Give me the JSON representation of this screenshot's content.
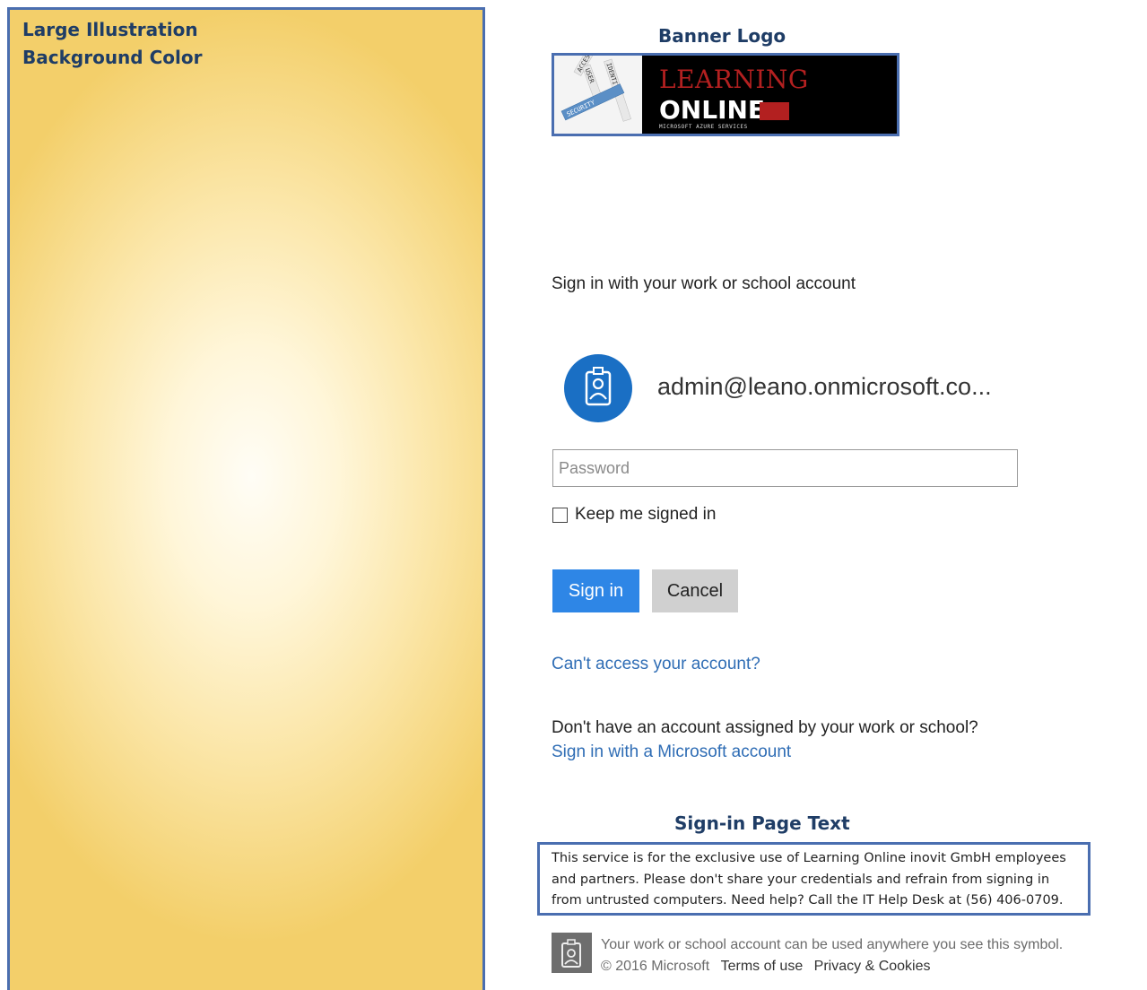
{
  "annotations": {
    "illustration_label_line1": "Large Illustration",
    "illustration_label_line2": "Background Color",
    "banner_logo_label": "Banner Logo",
    "signin_page_text_label": "Sign-in Page Text"
  },
  "logo": {
    "art_words": [
      "ACCESS",
      "USER",
      "IDENTITY",
      "SECURITY"
    ],
    "line1": "LEARNING",
    "line2": "ONLINE",
    "tagline": "MICROSOFT AZURE SERVICES"
  },
  "signin": {
    "heading": "Sign in with your work or school account",
    "account": "admin@leano.onmicrosoft.co...",
    "password_placeholder": "Password",
    "keep_signed_in": "Keep me signed in",
    "sign_in_button": "Sign in",
    "cancel_button": "Cancel",
    "cant_access_link": "Can't access your account?",
    "no_account_text": "Don't have an account assigned by your work or school?",
    "microsoft_account_link": "Sign in with a Microsoft account",
    "page_text": "This service is for the exclusive use of Learning Online inovit GmbH employees and partners. Please don't share your credentials and refrain from signing in from untrusted computers. Need help? Call the IT Help Desk at (56) 406-0709."
  },
  "footer": {
    "text": "Your work or school account can be used anywhere you see this symbol. © 2016 Microsoft",
    "terms": "Terms of use",
    "privacy": "Privacy & Cookies"
  },
  "colors": {
    "accent_blue": "#2e86e6",
    "link_blue": "#2f6db5",
    "annotation_border": "#4a6eb0",
    "illustration_gold": "#f3cf6a"
  },
  "icons": {
    "avatar": "badge-user-icon",
    "footer": "account-badge-icon"
  }
}
